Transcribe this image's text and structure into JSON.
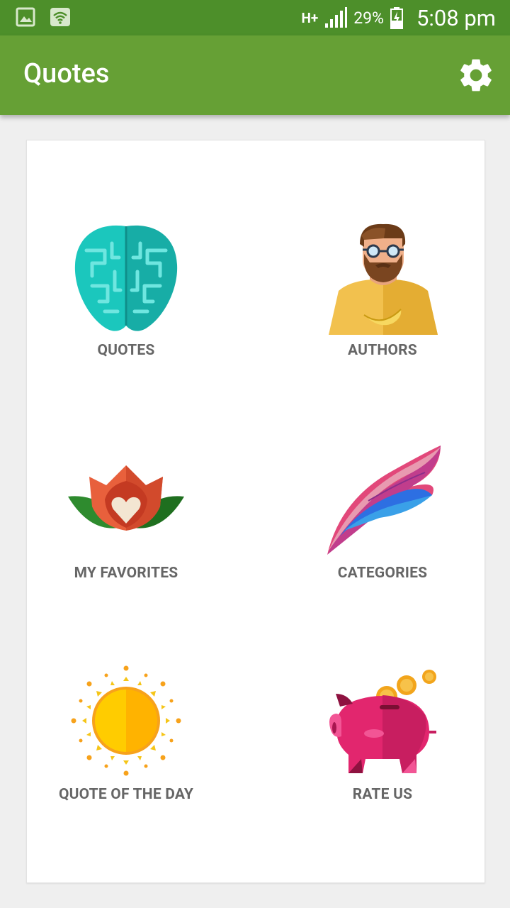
{
  "status_bar": {
    "network": "H+",
    "battery": "29%",
    "time": "5:08 pm"
  },
  "app_bar": {
    "title": "Quotes",
    "settings_icon": "gear-icon"
  },
  "tiles": [
    {
      "label": "QUOTES",
      "icon": "brain-icon"
    },
    {
      "label": "AUTHORS",
      "icon": "author-avatar-icon"
    },
    {
      "label": "MY FAVORITES",
      "icon": "lotus-heart-icon"
    },
    {
      "label": "CATEGORIES",
      "icon": "feather-icon"
    },
    {
      "label": "QUOTE OF THE DAY",
      "icon": "sun-icon"
    },
    {
      "label": "RATE US",
      "icon": "piggy-bank-icon"
    }
  ],
  "colors": {
    "status_bar": "#4d8f2a",
    "app_bar": "#66a035",
    "label": "#666666"
  }
}
